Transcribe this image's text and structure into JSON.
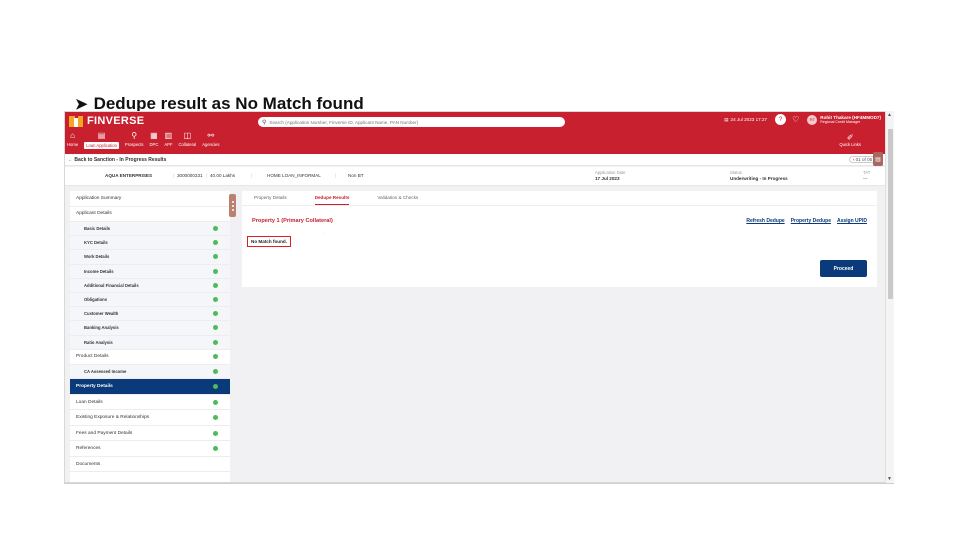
{
  "slide_title": "Dedupe result as No Match found",
  "app": {
    "name": "FINVERSE",
    "search_placeholder": "Search (Application Number, Finverse ID, Applicant Name, PAN Number)",
    "date": "24 Jul 2023 17:27",
    "user_name": "Rohit Thakare (HF4MMOD7)",
    "user_role": "Regional Credit Manager",
    "user_initials": "RT",
    "quick_links": "Quick Links",
    "nav": [
      "Home",
      "Loan Application",
      "Prospects",
      "DPC",
      "APF",
      "Collateral",
      "Agencies"
    ]
  },
  "backbar": {
    "back_label": "Back to Sanction - In Progress Results",
    "pager": "01 of 05"
  },
  "info": {
    "applicant": "AQUA ENTERPRISES",
    "app_number": "3000000331",
    "amount": "40.00 Lakhs",
    "product": "HOME LOAN_INFORMAL",
    "type": "Non BT",
    "app_date_label": "Application Date",
    "app_date": "17 Jul 2023",
    "status_label": "Status",
    "status": "Underwriting - In Progress",
    "tat_label": "TAT",
    "tat": "---"
  },
  "sidebar": [
    {
      "label": "Application Summary",
      "kind": "top",
      "dot": false
    },
    {
      "label": "Applicant Details",
      "kind": "top",
      "dot": false
    },
    {
      "label": "Basic Details",
      "kind": "sub",
      "dot": true
    },
    {
      "label": "KYC Details",
      "kind": "sub",
      "dot": true
    },
    {
      "label": "Work Details",
      "kind": "sub",
      "dot": true
    },
    {
      "label": "Income Details",
      "kind": "sub",
      "dot": true
    },
    {
      "label": "Additional Financial Details",
      "kind": "sub",
      "dot": true
    },
    {
      "label": "Obligations",
      "kind": "sub",
      "dot": true
    },
    {
      "label": "Customer Wealth",
      "kind": "sub",
      "dot": true
    },
    {
      "label": "Banking Analysis",
      "kind": "sub",
      "dot": true
    },
    {
      "label": "Ratio Analysis",
      "kind": "sub",
      "dot": true
    },
    {
      "label": "Product Details",
      "kind": "top",
      "dot": true
    },
    {
      "label": "CA Assessed Income",
      "kind": "sub",
      "dot": true
    },
    {
      "label": "Property Details",
      "kind": "active",
      "dot": true
    },
    {
      "label": "Loan Details",
      "kind": "top",
      "dot": true
    },
    {
      "label": "Existing Exposure & Relationships",
      "kind": "top",
      "dot": true
    },
    {
      "label": "Fees and Payment Details",
      "kind": "top",
      "dot": true
    },
    {
      "label": "References",
      "kind": "top",
      "dot": true
    },
    {
      "label": "Documents",
      "kind": "top",
      "dot": false
    }
  ],
  "tabs": [
    "Property Details",
    "Dedupe Results",
    "Validation & Checks"
  ],
  "panel": {
    "property_title": "Property 1 (Primary Collateral)",
    "links": [
      "Refresh Dedupe",
      "Property Dedupe",
      "Assign UPID"
    ],
    "no_match": "No Match found.",
    "proceed": "Proceed"
  },
  "colors": {
    "brand": "#c8202f",
    "navy": "#0b3a7a",
    "success": "#4cbb5a"
  }
}
